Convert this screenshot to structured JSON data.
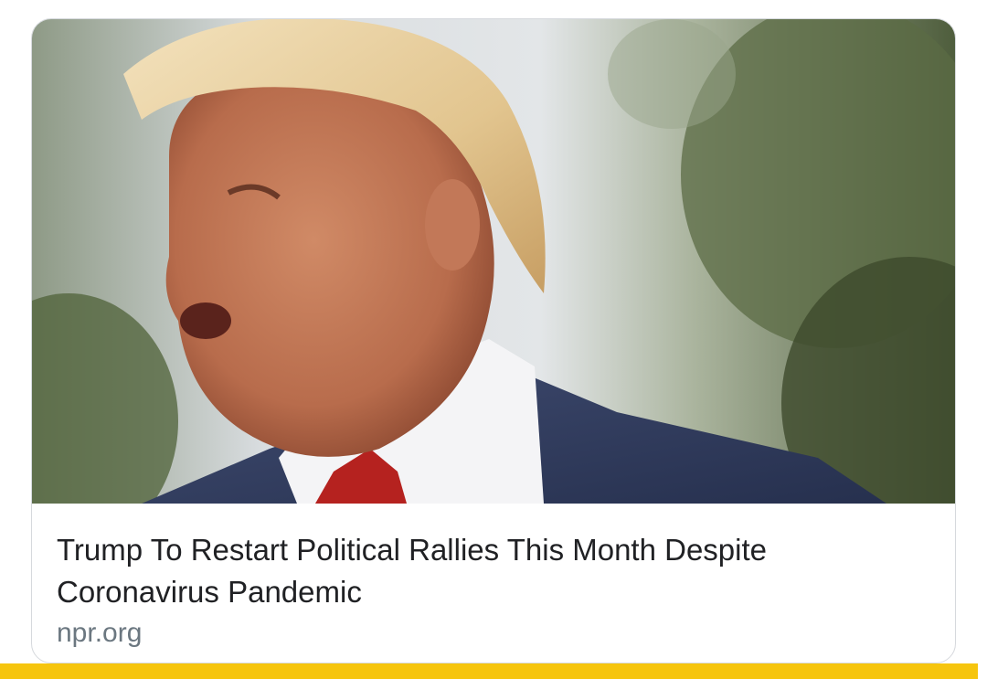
{
  "link_preview": {
    "image": {
      "icon": "news-photo",
      "alt": ""
    },
    "headline": "Trump To Restart Political Rallies This Month Despite Coronavirus Pandemic",
    "source": "npr.org"
  },
  "colors": {
    "headline": "#202124",
    "source": "#6b7780",
    "card_border": "#d6d9dd",
    "accent_bar": "#f6c50e"
  }
}
